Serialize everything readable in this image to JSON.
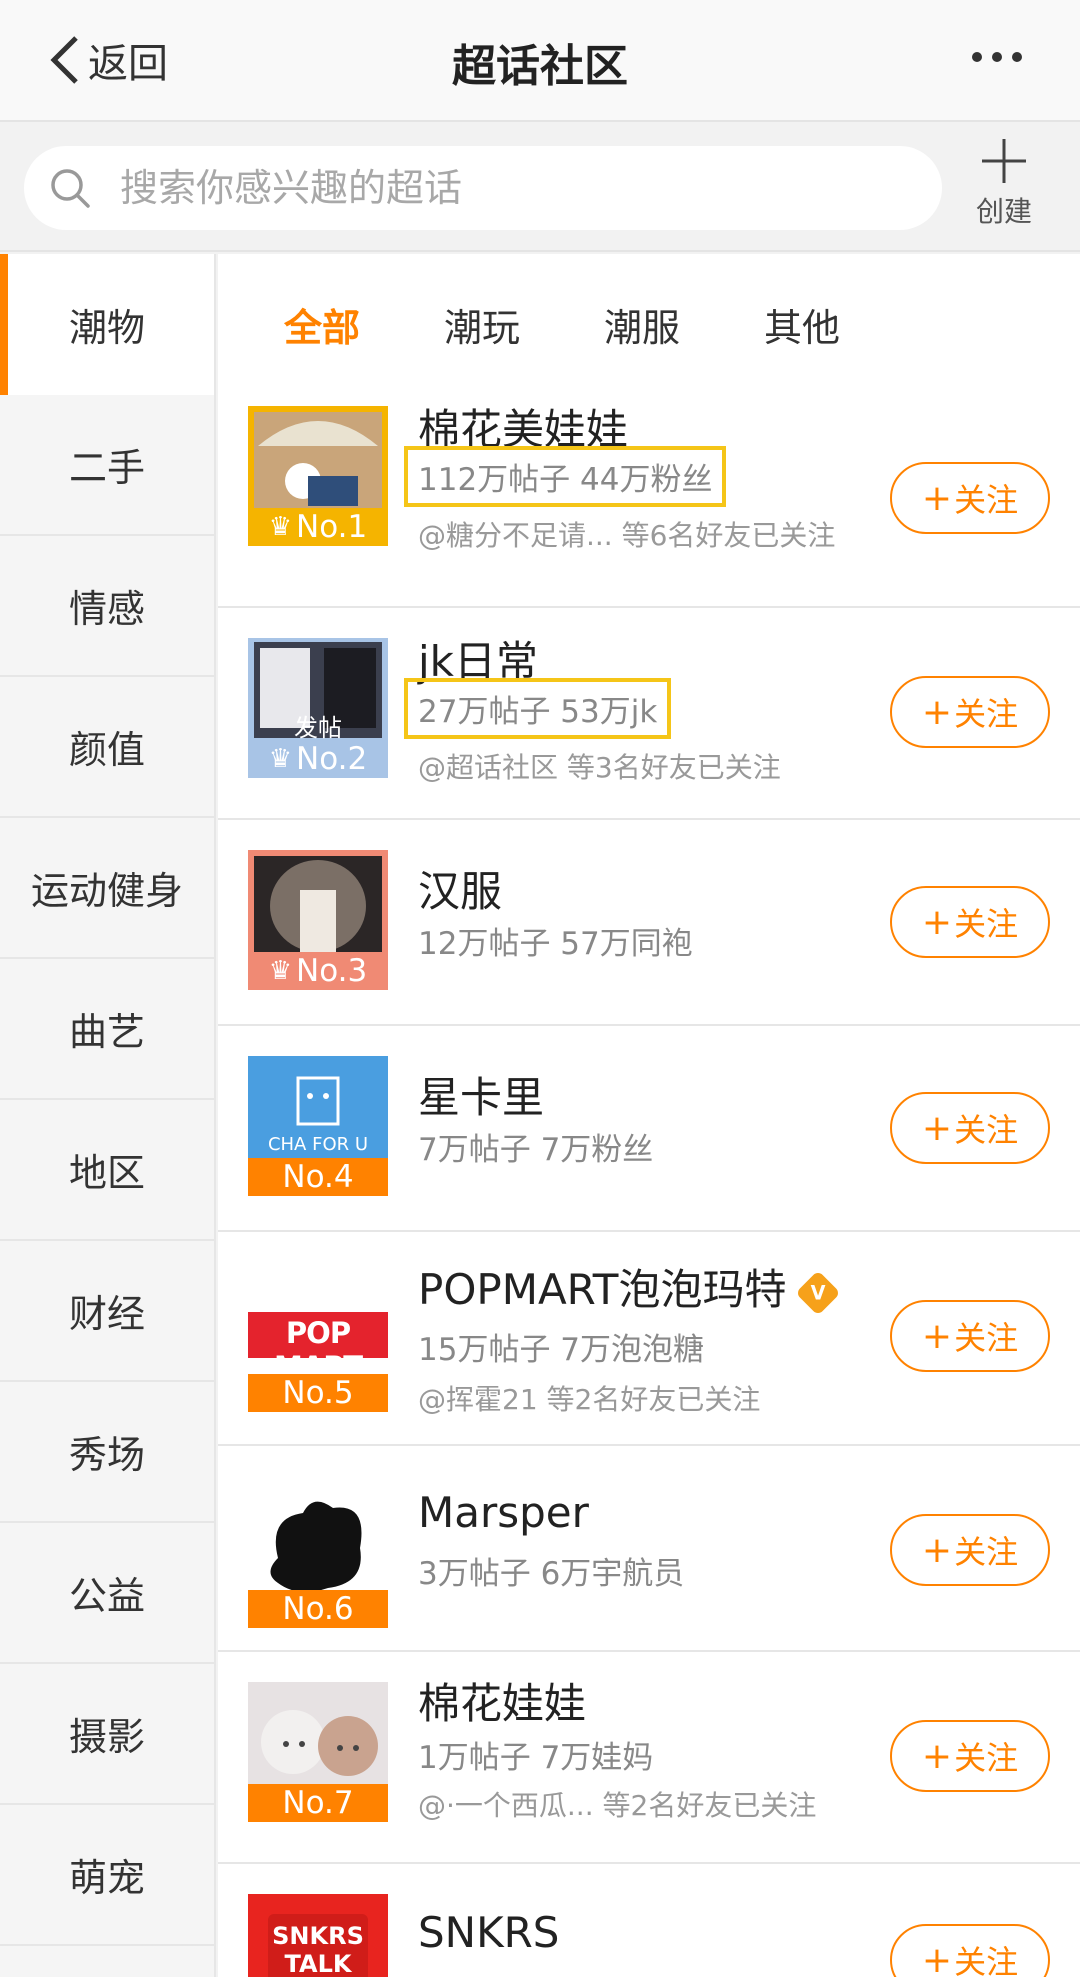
{
  "header": {
    "back_label": "返回",
    "title": "超话社区"
  },
  "search": {
    "placeholder": "搜索你感兴趣的超话",
    "create_label": "创建"
  },
  "sidebar": {
    "items": [
      "潮物",
      "二手",
      "情感",
      "颜值",
      "运动健身",
      "曲艺",
      "地区",
      "财经",
      "秀场",
      "公益",
      "摄影",
      "萌宠"
    ],
    "active": "潮物"
  },
  "tabs": {
    "items": [
      "全部",
      "潮玩",
      "潮服",
      "其他"
    ],
    "active": "全部"
  },
  "follow_label": "关注",
  "topics": [
    {
      "name": "棉花美娃娃",
      "stats": "112万帖子 44万粉丝",
      "friends": "@糖分不足请... 等6名好友已关注",
      "rank": "No.1",
      "rank_color": "#f5b400",
      "has_crown": true
    },
    {
      "name": "jk日常",
      "stats": "27万帖子 53万jk",
      "friends": "@超话社区 等3名好友已关注",
      "rank": "No.2",
      "rank_color": "#a8c4e6",
      "has_crown": true,
      "thumb_text": "发帖"
    },
    {
      "name": "汉服",
      "stats": "12万帖子 57万同袍",
      "friends": "",
      "rank": "No.3",
      "rank_color": "#f08a74",
      "has_crown": true
    },
    {
      "name": "星卡里",
      "stats": "7万帖子 7万粉丝",
      "friends": "",
      "rank": "No.4",
      "rank_color": "#ff8200",
      "has_crown": false,
      "thumb_text": "CHA FOR U"
    },
    {
      "name": "POPMART泡泡玛特",
      "stats": "15万帖子 7万泡泡糖",
      "friends": "@挥霍21 等2名好友已关注",
      "rank": "No.5",
      "rank_color": "#ff8200",
      "has_crown": false,
      "verified": true,
      "badge": "V",
      "thumb_text": "POP MART"
    },
    {
      "name": "Marsper",
      "stats": "3万帖子 6万宇航员",
      "friends": "",
      "rank": "No.6",
      "rank_color": "#ff8200",
      "has_crown": false
    },
    {
      "name": "棉花娃娃",
      "stats": "1万帖子 7万娃妈",
      "friends": "@·一个西瓜... 等2名好友已关注",
      "rank": "No.7",
      "rank_color": "#ff8200",
      "has_crown": false
    },
    {
      "name": "SNKRS",
      "stats": "",
      "friends": "",
      "rank": "",
      "rank_color": "#ff8200",
      "has_crown": false,
      "thumb_text": "SNKRS TALK"
    }
  ]
}
